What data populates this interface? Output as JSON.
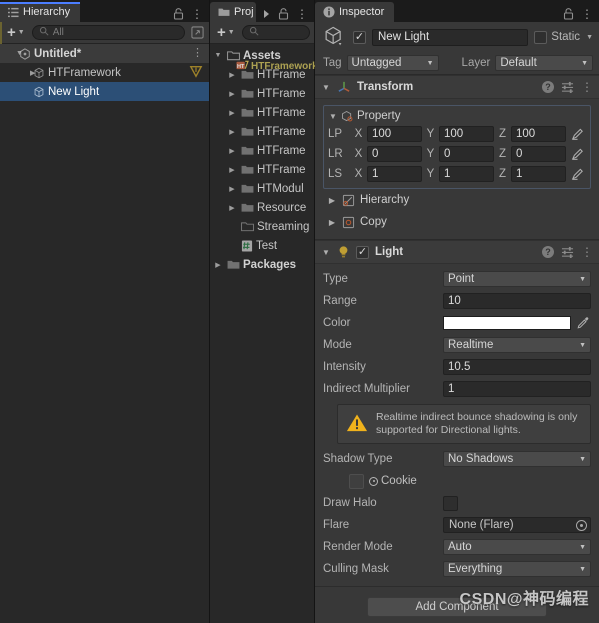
{
  "hierarchy": {
    "tab": {
      "label": "Hierarchy",
      "icon": "hierarchy-list-icon",
      "focused": true
    },
    "toolbar": {
      "create_label": "+",
      "search_placeholder": "All",
      "search_value": "",
      "search_icon": "search-icon",
      "dropdown_icon": "chevron-down-icon",
      "visibility_icon": "scene-visibility-icon"
    },
    "rows": [
      {
        "label": "Untitled*",
        "icon": "scene-icon",
        "indent": 0,
        "expanded": true,
        "selected": false,
        "kebab": true
      },
      {
        "label": "HTFramework",
        "icon": "gameobject-cube-icon",
        "indent": 1,
        "expanded": false,
        "selected": false,
        "badge": "htframework-logo-icon"
      },
      {
        "label": "New Light",
        "icon": "gameobject-cube-icon",
        "indent": 2,
        "expanded": null,
        "selected": true
      }
    ]
  },
  "project": {
    "tab": {
      "label": "Proj",
      "icon": "folder-icon",
      "overflow_icon": "tab-overflow-arrow-icon"
    },
    "toolbar": {
      "create_label": "+",
      "search_placeholder": "",
      "search_icon": "search-icon"
    },
    "rows": [
      {
        "label": "Assets",
        "icon": "folder-open-icon",
        "indent": 0,
        "expanded": true,
        "bold": true
      },
      {
        "label": "HTFrame",
        "icon": "folder-icon",
        "indent": 1,
        "expanded": false,
        "bold": false
      },
      {
        "label": "HTFrame",
        "icon": "folder-icon",
        "indent": 1,
        "expanded": false,
        "bold": false
      },
      {
        "label": "HTFrame",
        "icon": "folder-icon",
        "indent": 1,
        "expanded": false,
        "bold": false
      },
      {
        "label": "HTFrame",
        "icon": "folder-icon",
        "indent": 1,
        "expanded": false,
        "bold": false
      },
      {
        "label": "HTFrame",
        "icon": "folder-icon",
        "indent": 1,
        "expanded": false,
        "bold": false
      },
      {
        "label": "HTFrame",
        "icon": "folder-icon",
        "indent": 1,
        "expanded": false,
        "bold": false
      },
      {
        "label": "HTModul",
        "icon": "folder-icon",
        "indent": 1,
        "expanded": false,
        "bold": false
      },
      {
        "label": "Resource",
        "icon": "folder-icon",
        "indent": 1,
        "expanded": false,
        "bold": false
      },
      {
        "label": "Streaming",
        "icon": "folder-empty-icon",
        "indent": 1,
        "expanded": null,
        "bold": false
      },
      {
        "label": "Test",
        "icon": "csharp-script-icon",
        "indent": 1,
        "expanded": null,
        "bold": false
      },
      {
        "label": "Packages",
        "icon": "folder-icon",
        "indent": 0,
        "expanded": false,
        "bold": true
      }
    ],
    "overlay_tooltip": "HTFramework"
  },
  "inspector": {
    "tab": {
      "label": "Inspector",
      "icon": "info-icon"
    },
    "object": {
      "enabled": true,
      "name": "New Light",
      "prefab_icon": "gameobject-cube-icon",
      "static_label": "Static",
      "tag_label": "Tag",
      "tag_value": "Untagged",
      "layer_label": "Layer",
      "layer_value": "Default"
    },
    "transform": {
      "title": "Transform",
      "icon": "transform-axis-icon",
      "property_foldout": "Property",
      "rows": [
        {
          "name": "LP",
          "x": "100",
          "y": "100",
          "z": "100"
        },
        {
          "name": "LR",
          "x": "0",
          "y": "0",
          "z": "0"
        },
        {
          "name": "LS",
          "x": "1",
          "y": "1",
          "z": "1"
        }
      ],
      "axis_labels": {
        "x": "X",
        "y": "Y",
        "z": "Z"
      },
      "subfolds": [
        {
          "label": "Hierarchy",
          "icon": "hierarchy-toggle-icon"
        },
        {
          "label": "Copy",
          "icon": "copy-icon"
        }
      ]
    },
    "light": {
      "title": "Light",
      "icon": "light-bulb-icon",
      "enabled": true,
      "fields": [
        {
          "label": "Type",
          "kind": "dropdown",
          "value": "Point"
        },
        {
          "label": "Range",
          "kind": "text",
          "value": "10"
        },
        {
          "label": "Color",
          "kind": "color",
          "value": "#FFFFFF",
          "picker_icon": "eyedropper-icon"
        },
        {
          "label": "Mode",
          "kind": "dropdown",
          "value": "Realtime"
        },
        {
          "label": "Intensity",
          "kind": "text",
          "value": "10.5"
        },
        {
          "label": "Indirect Multiplier",
          "kind": "text",
          "value": "1"
        }
      ],
      "warning": {
        "icon": "warning-triangle-icon",
        "text": "Realtime indirect bounce shadowing is only supported for Directional lights.",
        "color": "#f0b21c"
      },
      "fields2": [
        {
          "label": "Shadow Type",
          "kind": "dropdown",
          "value": "No Shadows"
        }
      ],
      "cookie": {
        "label": "Cookie",
        "icon": "object-picker-icon",
        "value": ""
      },
      "fields3": [
        {
          "label": "Draw Halo",
          "kind": "checkbox",
          "value": false
        },
        {
          "label": "Flare",
          "kind": "object",
          "value": "None (Flare)",
          "picker_icon": "object-picker-icon"
        },
        {
          "label": "Render Mode",
          "kind": "dropdown",
          "value": "Auto"
        },
        {
          "label": "Culling Mask",
          "kind": "dropdown",
          "value": "Everything"
        }
      ]
    },
    "add_component_label": "Add Component"
  },
  "panel_icons": {
    "lock": "lock-icon",
    "menu": "kebab-menu-icon",
    "help": "help-icon",
    "settings": "settings-sliders-icon"
  },
  "watermark": "CSDN@神码编程",
  "colors": {
    "panel_bg": "#383838",
    "tree_bg": "#282828",
    "selection_blue": "#2c4f76",
    "tab_accent": "#4c7eff",
    "playmode_strip": "#6b6330",
    "warning_yellow": "#f0b21c"
  }
}
